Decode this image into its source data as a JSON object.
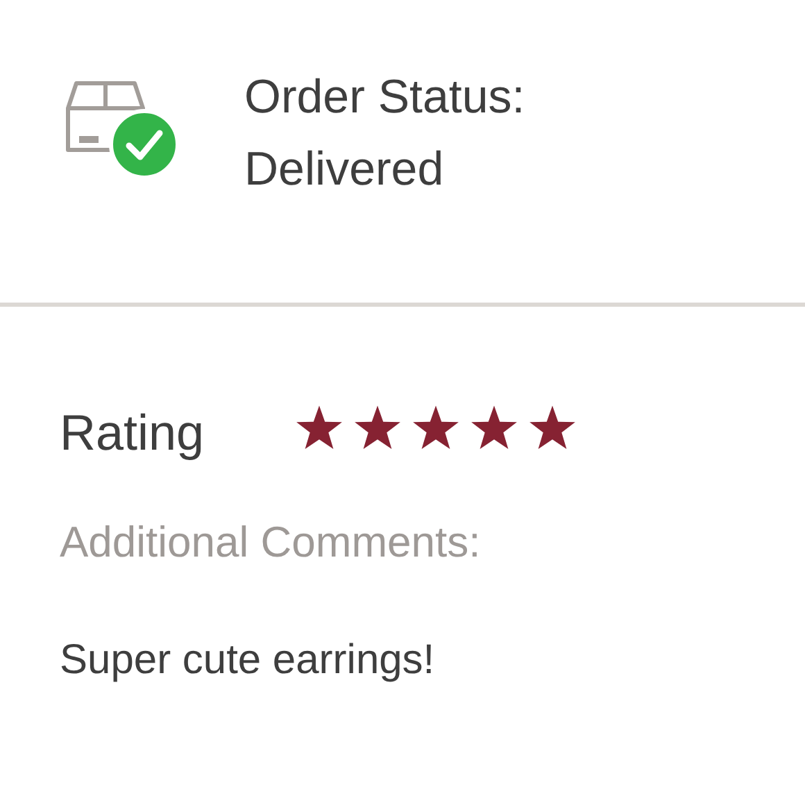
{
  "order_status": {
    "label": "Order Status:",
    "value": "Delivered"
  },
  "rating": {
    "label": "Rating",
    "stars": 5
  },
  "comments": {
    "label": "Additional Comments:",
    "text": "Super cute earrings!"
  }
}
